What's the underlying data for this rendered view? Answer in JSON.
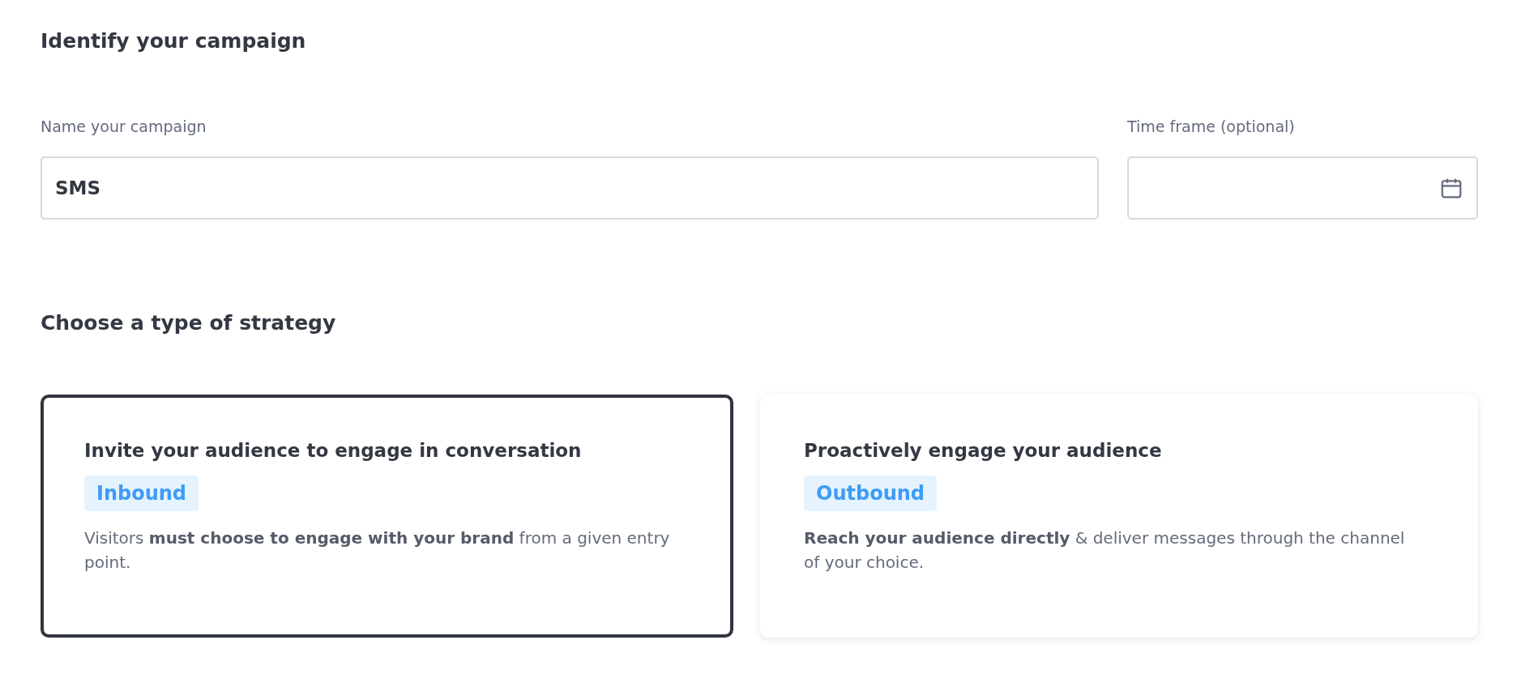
{
  "identify": {
    "heading": "Identify your campaign",
    "fields": [
      {
        "kind": "text",
        "label": "Name your campaign",
        "value": "SMS"
      },
      {
        "kind": "date",
        "label": "Time frame (optional)"
      }
    ]
  },
  "strategy": {
    "heading": "Choose a type of strategy",
    "cards": [
      {
        "title": "Invite your audience to engage in conversation",
        "tag": "Inbound",
        "description": "Visitors **must choose to engage with your brand** from a given entry point.",
        "selected": true
      },
      {
        "title": "Proactively engage your audience",
        "tag": "Outbound",
        "description": "**Reach your audience directly** & deliver messages through the channel of your choice.",
        "selected": false
      }
    ]
  }
}
